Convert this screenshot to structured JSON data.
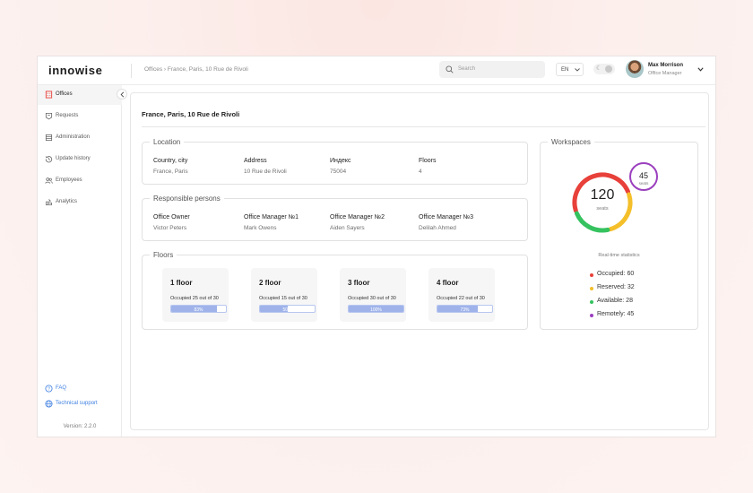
{
  "app": {
    "logo": "innowise"
  },
  "header": {
    "breadcrumb": "Offices › France, Paris, 10 Rue de Rivoli",
    "search_placeholder": "Search",
    "language": "EN",
    "user_name": "Max Morrison",
    "user_role": "Office Manager"
  },
  "sidebar": {
    "items": [
      {
        "label": "Offices",
        "icon": "office-icon",
        "active": true
      },
      {
        "label": "Requests",
        "icon": "requests-icon",
        "active": false
      },
      {
        "label": "Administration",
        "icon": "administration-icon",
        "active": false
      },
      {
        "label": "Update history",
        "icon": "history-icon",
        "active": false
      },
      {
        "label": "Employees",
        "icon": "employees-icon",
        "active": false
      },
      {
        "label": "Analytics",
        "icon": "analytics-icon",
        "active": false
      }
    ],
    "faq": "FAQ",
    "support": "Technical support",
    "version": "Version: 2.2.0"
  },
  "page": {
    "title": "France, Paris, 10 Rue de Rivoli"
  },
  "location": {
    "legend": "Location",
    "fields": [
      {
        "label": "Country, city",
        "value": "France, Paris"
      },
      {
        "label": "Address",
        "value": "10 Rue de Rivoli"
      },
      {
        "label": "Индекс",
        "value": "75004"
      },
      {
        "label": "Floors",
        "value": "4"
      }
    ]
  },
  "responsible": {
    "legend": "Responsible persons",
    "fields": [
      {
        "label": "Office Owner",
        "value": "Victor Peters"
      },
      {
        "label": "Office Manager №1",
        "value": "Mark Owens"
      },
      {
        "label": "Office Manager №2",
        "value": "Aiden Sayers"
      },
      {
        "label": "Office Manager №3",
        "value": "Delilah Ahmed"
      }
    ]
  },
  "floors": {
    "legend": "Floors",
    "items": [
      {
        "name": "1 floor",
        "occupied": "Occupied 25 out of 30",
        "percent_label": "83%",
        "fraction": 0.83
      },
      {
        "name": "2 floor",
        "occupied": "Occupied 15 out of 30",
        "percent_label": "50%",
        "fraction": 0.5
      },
      {
        "name": "3 floor",
        "occupied": "Occupied 30 out of 30",
        "percent_label": "100%",
        "fraction": 1.0
      },
      {
        "name": "4 floor",
        "occupied": "Occupied 22 out of 30",
        "percent_label": "73%",
        "fraction": 0.73
      }
    ]
  },
  "workspaces": {
    "legend": "Workspaces",
    "total": "120",
    "total_unit": "seats",
    "remote": "45",
    "remote_unit": "seats",
    "stats_title": "Real-time statistics",
    "stats": [
      {
        "label": "Occupied: 60",
        "value": 60,
        "color": "#e8403a"
      },
      {
        "label": "Reserved: 32",
        "value": 32,
        "color": "#f4bf2a"
      },
      {
        "label": "Available: 28",
        "value": 28,
        "color": "#35c25f"
      },
      {
        "label": "Remotely: 45",
        "value": 45,
        "color": "#9b3fbe"
      }
    ]
  },
  "colors": {
    "accent": "#3d7fe0",
    "bar_fill": "#9fb3ea",
    "active_nav": "#f5f5f5",
    "office_icon": "#e8403a"
  }
}
